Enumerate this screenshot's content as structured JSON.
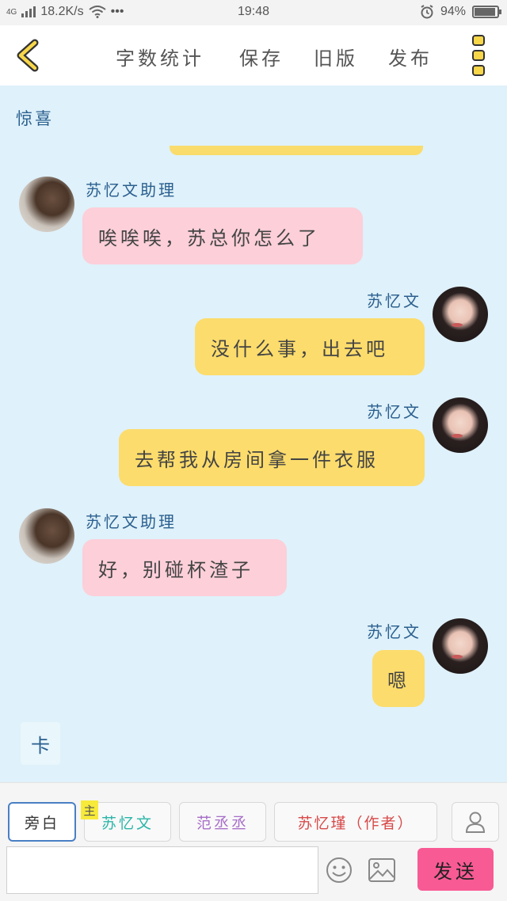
{
  "status_bar": {
    "network": "4G",
    "speed": "18.2K/s",
    "more": "•••",
    "time": "19:48",
    "battery": "94%",
    "battery_level": 0.94
  },
  "header": {
    "menu": [
      "字数统计",
      "保存",
      "旧版",
      "发布"
    ]
  },
  "scene_title": "惊喜",
  "messages": [
    {
      "speaker": "苏忆文助理",
      "text": "唉唉唉，苏总你怎么了",
      "side": "left"
    },
    {
      "speaker": "苏忆文",
      "text": "没什么事，出去吧",
      "side": "right"
    },
    {
      "speaker": "苏忆文",
      "text": "去帮我从房间拿一件衣服",
      "side": "right"
    },
    {
      "speaker": "苏忆文助理",
      "text": "好，别碰杯渣子",
      "side": "left"
    },
    {
      "speaker": "苏忆文",
      "text": "嗯",
      "side": "right"
    }
  ],
  "card_label": "卡",
  "roles": [
    {
      "label": "旁白",
      "color": "#333333"
    },
    {
      "label": "苏忆文",
      "color": "#2bb5a8"
    },
    {
      "label": "范丞丞",
      "color": "#a86fc8"
    },
    {
      "label": "苏忆瑾（作者）",
      "color": "#d84a4a"
    }
  ],
  "main_badge": "主",
  "send_label": "发送",
  "colors": {
    "background": "#dff1fa",
    "bubble_pink": "#fccfd9",
    "bubble_yellow": "#fcdc6c",
    "send": "#f85a94",
    "speaker": "#2a5f8f"
  }
}
